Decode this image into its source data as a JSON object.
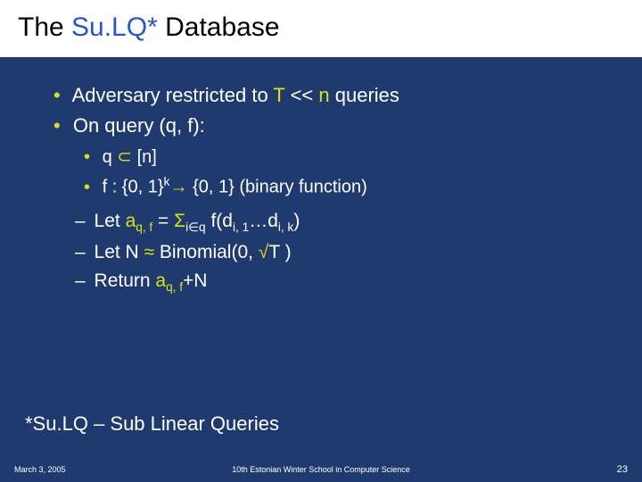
{
  "title": {
    "prefix": "The ",
    "accent": "Su.LQ*",
    "suffix": " Database"
  },
  "bullets": {
    "b1": {
      "t1": "Adversary restricted to ",
      "T": "T",
      "t2": " << ",
      "n": "n",
      "t3": " queries"
    },
    "b2": "On query (q, f):",
    "sub1": {
      "t1": "q ",
      "sym": "⊂",
      "t2": " [n]"
    },
    "sub2": {
      "t1": "f : {0, 1}",
      "k": "k",
      "arrow": "→",
      "t2": " {0, 1}  (binary function)"
    },
    "let1": {
      "dash": "–",
      "t1": " Let ",
      "a": "a",
      "sub_a": "q, f",
      "t2": " = ",
      "sigma": "Σ",
      "sub_sig": "i∈q",
      "t3": " f(d",
      "sub_d1": "i, 1",
      "t4": "…d",
      "sub_d2": "i, k",
      "t5": ")"
    },
    "let2": {
      "dash": "–",
      "t1": " Let N ",
      "approx": "≈",
      "t2": " Binomial(0, ",
      "sqrt": "√",
      "T": "T",
      "t3": " )"
    },
    "ret": {
      "dash": "–",
      "t1": " Return ",
      "a": "a",
      "sub_a": "q, f",
      "t2": "+N"
    }
  },
  "footnote": "*Su.LQ – Sub Linear Queries",
  "footer": {
    "date": "March 3, 2005",
    "mid": "10th Estonian Winter School in Computer Science",
    "page": "23"
  }
}
